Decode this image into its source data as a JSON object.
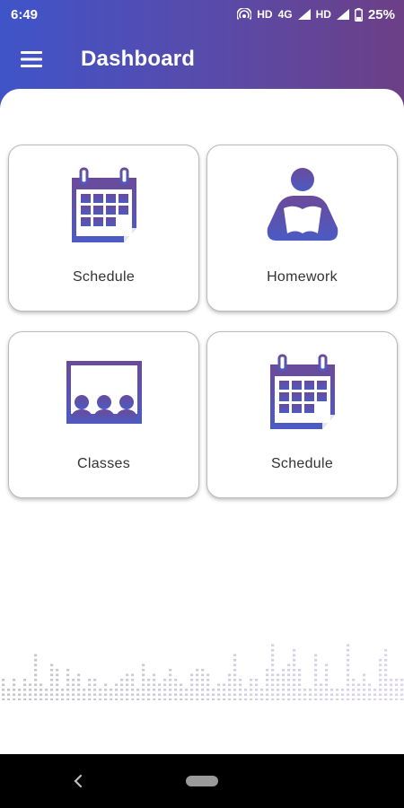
{
  "status": {
    "time": "6:49",
    "hd1": "HD",
    "net": "4G",
    "hd2": "HD",
    "battery": "25%"
  },
  "appbar": {
    "title": "Dashboard",
    "menu_icon": "hamburger-menu-icon"
  },
  "cards": [
    {
      "label": "Schedule",
      "icon": "calendar-icon"
    },
    {
      "label": "Homework",
      "icon": "reading-person-icon"
    },
    {
      "label": "Classes",
      "icon": "classroom-icon"
    },
    {
      "label": "Schedule",
      "icon": "calendar-icon"
    }
  ],
  "colors": {
    "gradient_start": "#3f54c9",
    "gradient_end": "#6c3f86",
    "icon_top": "#6b4a9a",
    "icon_bottom": "#4b5bc4"
  }
}
